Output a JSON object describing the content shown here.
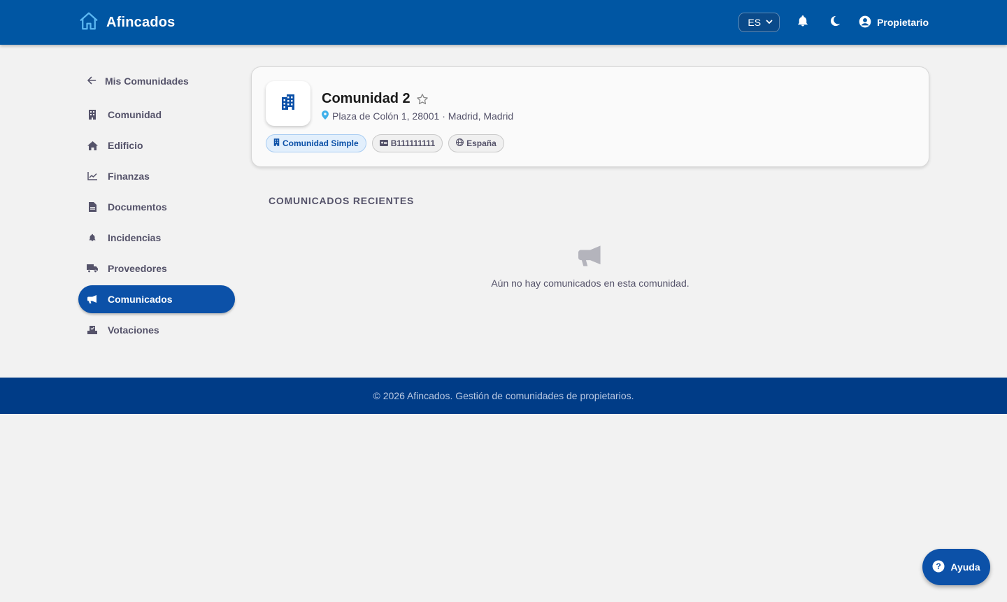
{
  "header": {
    "brand": "Afincados",
    "language": "ES",
    "user_label": "Propietario"
  },
  "sidebar": {
    "back_label": "Mis Comunidades",
    "items": [
      {
        "label": "Comunidad",
        "icon": "community-icon"
      },
      {
        "label": "Edificio",
        "icon": "home-icon"
      },
      {
        "label": "Finanzas",
        "icon": "chart-line-icon"
      },
      {
        "label": "Documentos",
        "icon": "document-icon"
      },
      {
        "label": "Incidencias",
        "icon": "bell-icon"
      },
      {
        "label": "Proveedores",
        "icon": "truck-icon"
      },
      {
        "label": "Comunicados",
        "icon": "megaphone-icon",
        "active": true
      },
      {
        "label": "Votaciones",
        "icon": "ballot-icon"
      }
    ]
  },
  "community": {
    "name": "Comunidad 2",
    "address": "Plaza de Colón 1, 28001 · Madrid, Madrid",
    "chips": [
      {
        "label": "Comunidad Simple",
        "icon": "building-icon",
        "style": "primary"
      },
      {
        "label": "B111111111",
        "icon": "id-card-icon",
        "style": "default"
      },
      {
        "label": "España",
        "icon": "globe-icon",
        "style": "default"
      }
    ]
  },
  "announcements": {
    "section_title": "COMUNICADOS RECIENTES",
    "empty_message": "Aún no hay comunicados en esta comunidad."
  },
  "footer": {
    "text": "© 2026 Afincados. Gestión de comunidades de propietarios."
  },
  "help": {
    "label": "Ayuda"
  },
  "colors": {
    "header_bg": "#0056a3",
    "footer_bg": "#003c87",
    "accent": "#0c51a8",
    "page_bg": "#f2f2f2"
  }
}
